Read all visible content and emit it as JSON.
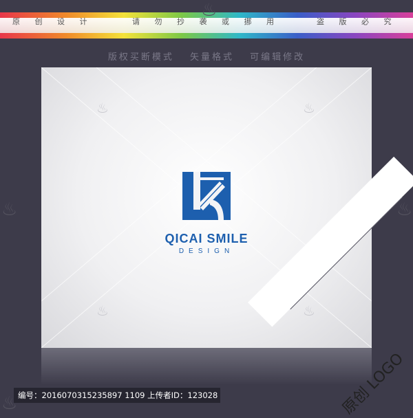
{
  "top_nav": {
    "left_text": "原 创 设 计",
    "middle_text": "请 勿 抄 袭 或 挪 用",
    "right_text": "盗 版 必 究"
  },
  "subtitle": {
    "items": [
      "版权买断模式",
      "矢量格式",
      "可编辑修改"
    ]
  },
  "logo": {
    "name": "QICAI SMILE",
    "tagline": "DESIGN",
    "color": "#1d5fae"
  },
  "footer": {
    "label": "编号：2016070315235897 1109 上传者ID：123028"
  },
  "corner_badge": {
    "text": "原创 LOGO"
  }
}
